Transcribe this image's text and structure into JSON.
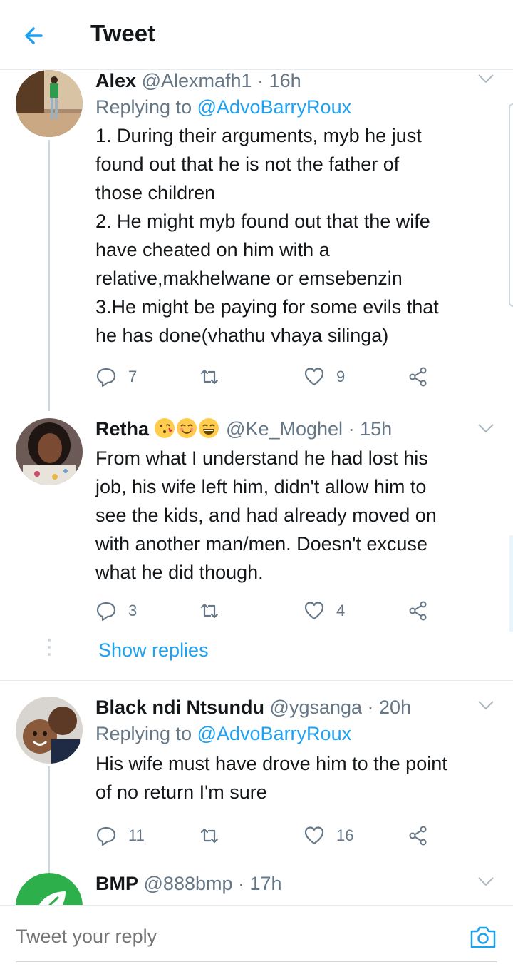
{
  "header": {
    "title": "Tweet"
  },
  "tweets": [
    {
      "name": "Alex",
      "handle": "@Alexmafh1",
      "time": "16h",
      "replying_prefix": "Replying to ",
      "replying_to": "@AdvoBarryRoux",
      "lines": [
        "1. During their arguments, myb he just",
        "found out that he is not the father of",
        "those children",
        "2. He might myb found out that the wife",
        "have cheated on him with a",
        "relative,makhelwane or emsebenzin",
        "3.He might be paying for some evils that",
        "he has done(vhathu vhaya silinga)"
      ],
      "replies": "7",
      "retweets": "",
      "likes": "9"
    },
    {
      "name": "Retha",
      "handle": "@Ke_Moghel",
      "time": "15h",
      "lines": [
        "From what I understand he had lost his",
        "job, his wife left him, didn't allow him to",
        "see the kids, and had already moved on",
        "with another man/men. Doesn't excuse",
        "what he did though."
      ],
      "replies": "3",
      "retweets": "",
      "likes": "4",
      "show_replies": "Show replies"
    },
    {
      "name": "Black ndi Ntsundu",
      "handle": "@ygsanga",
      "time": "20h",
      "replying_prefix": "Replying to ",
      "replying_to": "@AdvoBarryRoux",
      "lines": [
        "His wife must have drove him to the point",
        "of no return I'm sure"
      ],
      "replies": "11",
      "retweets": "",
      "likes": "16"
    },
    {
      "name": "BMP",
      "handle": "@888bmp",
      "time": "17h"
    }
  ],
  "separator": " · ",
  "reply_bar": {
    "placeholder": "Tweet your reply"
  },
  "colors": {
    "accent": "#1da1f2",
    "muted": "#657786",
    "text": "#14171a",
    "border": "#e6ecf0"
  },
  "icons": [
    "back-arrow-icon",
    "chevron-down-icon",
    "reply-icon",
    "retweet-icon",
    "heart-icon",
    "share-icon",
    "camera-icon",
    "face-blowing-kiss-emoji",
    "smiling-face-emoji",
    "grinning-face-emoji"
  ]
}
